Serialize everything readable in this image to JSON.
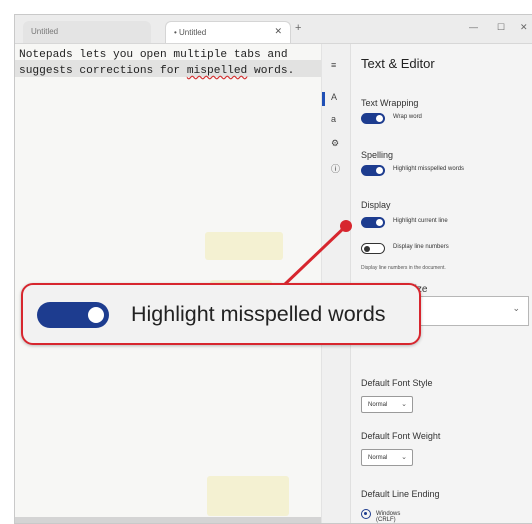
{
  "tabs": [
    {
      "label": "Untitled"
    },
    {
      "label": "• Untitled",
      "active": true
    }
  ],
  "editor": {
    "lines": [
      "Notepads lets you open multiple tabs and",
      [
        "suggests corrections for ",
        "mispelled",
        " words."
      ]
    ]
  },
  "settings": {
    "title": "Text & Editor",
    "sections": {
      "text_wrapping": {
        "heading": "Text Wrapping",
        "toggle_label": "Wrap word",
        "on": true
      },
      "spelling": {
        "heading": "Spelling",
        "toggle_label": "Highlight misspelled words",
        "on": true
      },
      "display": {
        "heading": "Display",
        "highlight_line": {
          "label": "Highlight current line",
          "on": true
        },
        "line_numbers": {
          "label": "Display line numbers",
          "on": false
        },
        "hint": "Display line numbers in the document."
      },
      "font_size": {
        "heading": "Size"
      },
      "font_style": {
        "heading": "Default Font Style",
        "value": "Normal"
      },
      "font_weight": {
        "heading": "Default Font Weight",
        "value": "Normal"
      },
      "line_ending": {
        "heading": "Default Line Ending",
        "value": "Windows (CRLF)"
      }
    }
  },
  "callout": {
    "label": "Highlight misspelled words",
    "on": true,
    "color": "#d7262e"
  },
  "colors": {
    "accent": "#1d3c8f",
    "misspelling_underline": "#d32f2f"
  },
  "icons": [
    "close-icon",
    "plus-icon",
    "minimize-icon",
    "maximize-icon",
    "menu-icon",
    "font-icon",
    "settings-icon",
    "info-icon",
    "chevron-down-icon"
  ]
}
